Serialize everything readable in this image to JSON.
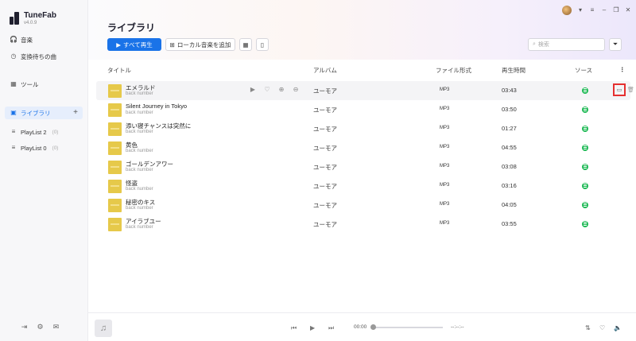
{
  "app": {
    "name": "TuneFab",
    "version": "v4.0.9"
  },
  "sidebar": {
    "items": [
      {
        "label": "音楽",
        "icon": "headphones-icon"
      },
      {
        "label": "変換待ちの曲",
        "icon": "clock-icon"
      },
      {
        "label": "ツール",
        "icon": "grid-icon"
      }
    ],
    "library": {
      "label": "ライブラリ",
      "icon": "library-icon",
      "add": "+"
    },
    "playlists": [
      {
        "label": "PlayList 2",
        "count": "(0)"
      },
      {
        "label": "PlayList 0",
        "count": "(0)"
      }
    ]
  },
  "header": {
    "title": "ライブラリ",
    "play_all": "すべて再生",
    "add_local": "ローカル音楽を追加",
    "search_placeholder": "検索"
  },
  "columns": {
    "title": "タイトル",
    "album": "アルバム",
    "format": "ファイル形式",
    "duration": "再生時間",
    "source": "ソース"
  },
  "rows": [
    {
      "title": "エメラルド",
      "artist": "back number",
      "album": "ユーモア",
      "format": "MP3",
      "duration": "03:43"
    },
    {
      "title": "Silent Journey in Tokyo",
      "artist": "back number",
      "album": "ユーモア",
      "format": "MP3",
      "duration": "03:50"
    },
    {
      "title": "添い寝チャンスは突然に",
      "artist": "back number",
      "album": "ユーモア",
      "format": "MP3",
      "duration": "01:27"
    },
    {
      "title": "黄色",
      "artist": "back number",
      "album": "ユーモア",
      "format": "MP3",
      "duration": "04:55"
    },
    {
      "title": "ゴールデンアワー",
      "artist": "back number",
      "album": "ユーモア",
      "format": "MP3",
      "duration": "03:08"
    },
    {
      "title": "怪盗",
      "artist": "back number",
      "album": "ユーモア",
      "format": "MP3",
      "duration": "03:16"
    },
    {
      "title": "秘密のキス",
      "artist": "back number",
      "album": "ユーモア",
      "format": "MP3",
      "duration": "04:05"
    },
    {
      "title": "アイラブユー",
      "artist": "back number",
      "album": "ユーモア",
      "format": "MP3",
      "duration": "03:55"
    }
  ],
  "player": {
    "current_time": "00:00",
    "total_time": "--:--:--"
  },
  "colors": {
    "accent": "#1a73e8",
    "spotify": "#1db954",
    "highlight_box": "#e53030"
  }
}
